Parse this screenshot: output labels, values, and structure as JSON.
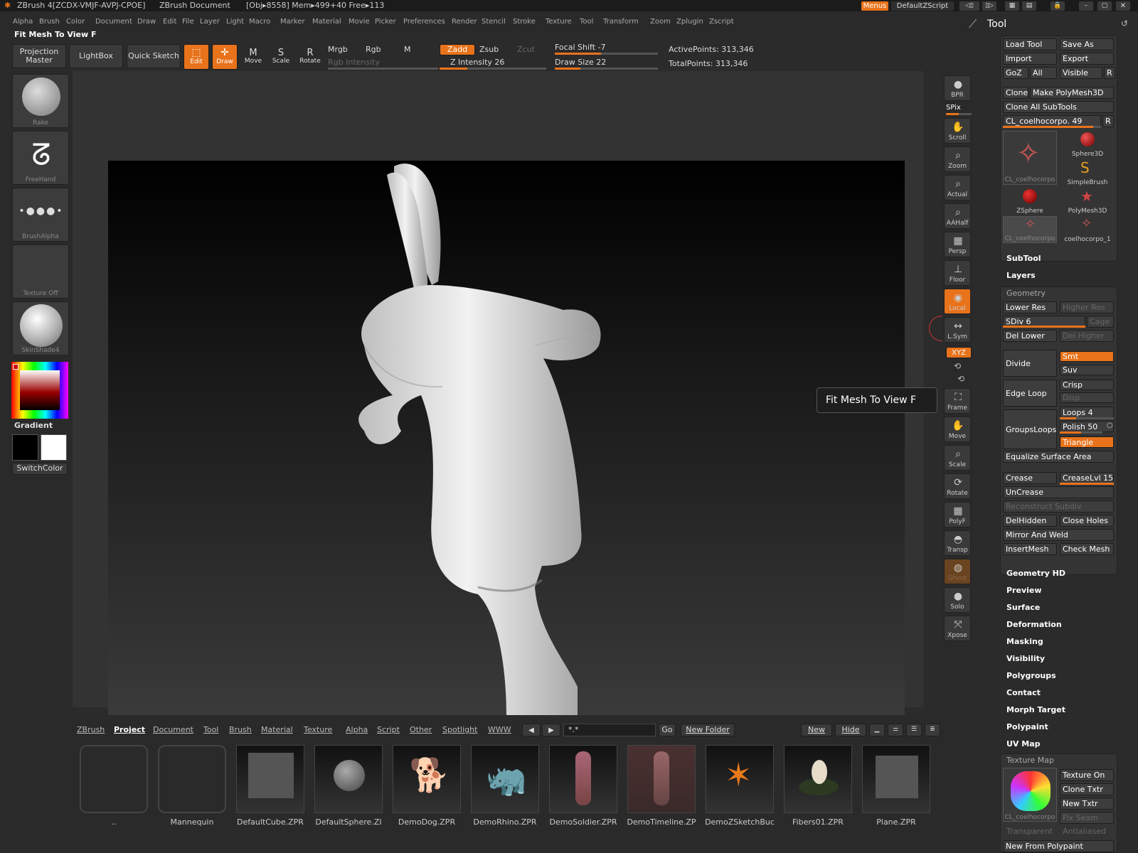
{
  "title": {
    "app": "ZBrush 4[ZCDX-VMJF-AVPJ-CPOE]",
    "doc": "ZBrush Document",
    "status": "[Obj▸8558] Mem▸499+40 Free▸113",
    "menus_btn": "Menus",
    "script": "DefaultZScript"
  },
  "menubar": [
    "Alpha",
    "Brush",
    "Color",
    "Document",
    "Draw",
    "Edit",
    "File",
    "Layer",
    "Light",
    "Macro",
    "Marker",
    "Material",
    "Movie",
    "Picker",
    "Preferences",
    "Render",
    "Stencil",
    "Stroke",
    "Texture",
    "Tool",
    "Transform",
    "Zoom",
    "Zplugin",
    "Zscript"
  ],
  "fitrow": "Fit Mesh To View   F",
  "toolbar": {
    "projection_master": "Projection Master",
    "lightbox": "LightBox",
    "quick_sketch": "Quick Sketch",
    "edit": "Edit",
    "draw": "Draw",
    "move": "Move",
    "scale": "Scale",
    "rotate": "Rotate",
    "mrgb": "Mrgb",
    "rgb": "Rgb",
    "m": "M",
    "rgb_intensity": "Rgb Intensity",
    "zadd": "Zadd",
    "zsub": "Zsub",
    "zcut": "Zcut",
    "z_intensity": "Z Intensity 26",
    "focal_shift": "Focal Shift -7",
    "draw_size": "Draw Size 22",
    "active_points": "ActivePoints: 313,346",
    "total_points": "TotalPoints: 313,346"
  },
  "left": {
    "rake": "Rake",
    "freehand": "FreeHand",
    "brushalpha": "BrushAlpha",
    "texture_off": "Texture Off",
    "skinshade": "SkinShade4",
    "gradient": "Gradient",
    "switchcolor": "SwitchColor"
  },
  "shelf": [
    "BPR",
    "SPix",
    "Scroll",
    "Zoom",
    "Actual",
    "AAHalf",
    "Persp",
    "Floor",
    "Local",
    "L.Sym",
    "XYZ",
    "Frame",
    "Move",
    "Scale",
    "Rotate",
    "PolyF",
    "Transp",
    "Ghost",
    "Solo",
    "Xpose"
  ],
  "tooltip": "Fit Mesh To View   F",
  "bottom_tabs": [
    "ZBrush",
    "Project",
    "Document",
    "Tool",
    "Brush",
    "Material",
    "Texture",
    "Alpha",
    "Script",
    "Other",
    "Spotlight",
    "WWW"
  ],
  "bottom": {
    "filter": "*.*",
    "go": "Go",
    "new_folder": "New Folder",
    "new": "New",
    "hide": "Hide"
  },
  "files": [
    "..",
    "Mannequin",
    "DefaultCube.ZPR",
    "DefaultSphere.ZI",
    "DemoDog.ZPR",
    "DemoRhino.ZPR",
    "DemoSoldier.ZPR",
    "DemoTimeline.ZP",
    "DemoZSketchBuc",
    "Fibers01.ZPR",
    "Plane.ZPR"
  ],
  "tool": {
    "title": "Tool",
    "load_tool": "Load Tool",
    "save_as": "Save As",
    "import": "Import",
    "export": "Export",
    "goz": "GoZ",
    "all": "All",
    "visible": "Visible",
    "r": "R",
    "clone": "Clone",
    "make_polymesh": "Make PolyMesh3D",
    "clone_all": "Clone All SubTools",
    "current": "CL_coelhocorpo. 49",
    "thumbs": [
      "CL_coelhocorpo",
      "Sphere3D",
      "SimpleBrush",
      "ZSphere",
      "PolyMesh3D",
      "CL_coelhocorpo",
      "coelhocorpo_1"
    ],
    "subtool": "SubTool",
    "layers": "Layers",
    "geometry": "Geometry",
    "lower_res": "Lower Res",
    "higher_res": "Higher Res",
    "sdiv": "SDiv 6",
    "cage": "Cage",
    "del_lower": "Del Lower",
    "del_higher": "Del Higher",
    "divide": "Divide",
    "smt": "Smt",
    "suv": "Suv",
    "crisp": "Crisp",
    "disp": "Disp",
    "edge_loop": "Edge Loop",
    "loops": "Loops 4",
    "polish": "Polish 50",
    "groups_loops": "GroupsLoops",
    "triangle": "Triangle",
    "equalize": "Equalize Surface Area",
    "crease": "Crease",
    "creaselvl": "CreaseLvl 15",
    "uncrease": "UnCrease",
    "reconstruct": "Reconstruct Subdiv",
    "delhidden": "DelHidden",
    "close_holes": "Close Holes",
    "mirror_weld": "Mirror And Weld",
    "insertmesh": "InsertMesh",
    "check_mesh": "Check Mesh",
    "sections": [
      "Geometry HD",
      "Preview",
      "Surface",
      "Deformation",
      "Masking",
      "Visibility",
      "Polygroups",
      "Contact",
      "Morph Target",
      "Polypaint",
      "UV Map"
    ],
    "texture_map": "Texture Map",
    "texture_on": "Texture On",
    "clone_txtr": "Clone Txtr",
    "new_txtr": "New Txtr",
    "fix_seam": "Fix Seam",
    "transparent": "Transparent",
    "antialiased": "Antialiased",
    "tex_thumb": "CL_coelhocorpo",
    "new_from_polypaint": "New From Polypaint"
  }
}
